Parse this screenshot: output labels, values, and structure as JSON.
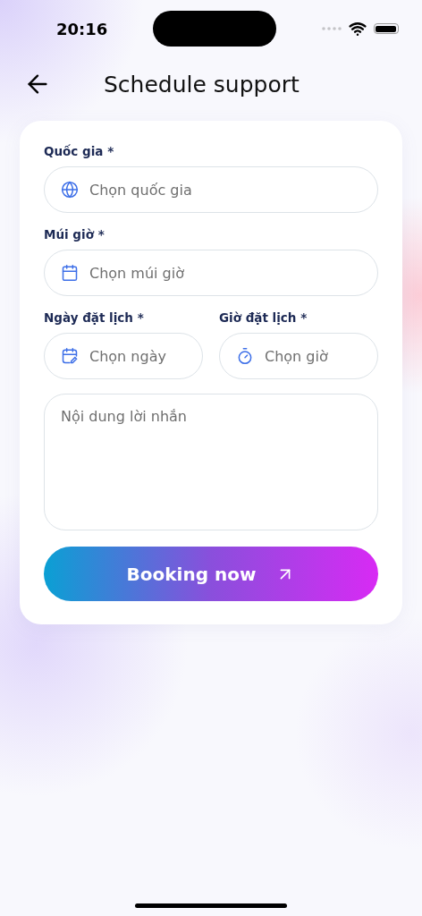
{
  "status_bar": {
    "time": "20:16"
  },
  "header": {
    "title": "Schedule support"
  },
  "form": {
    "rows": [
      {
        "fields": [
          {
            "label": "Quốc gia *",
            "placeholder": "Chọn quốc gia",
            "kind": "globe"
          }
        ]
      },
      {
        "fields": [
          {
            "label": "Múi giờ *",
            "placeholder": "Chọn múi giờ",
            "kind": "calendar"
          }
        ]
      },
      {
        "fields": [
          {
            "label": "Ngày đặt lịch *",
            "placeholder": "Chọn ngày",
            "kind": "calendar-edit"
          },
          {
            "label": "Giờ đặt lịch *",
            "placeholder": "Chọn giờ",
            "kind": "timer"
          }
        ]
      }
    ],
    "message": {
      "placeholder": "Nội dung lời nhắn"
    },
    "submit": {
      "label": "Booking now"
    }
  }
}
